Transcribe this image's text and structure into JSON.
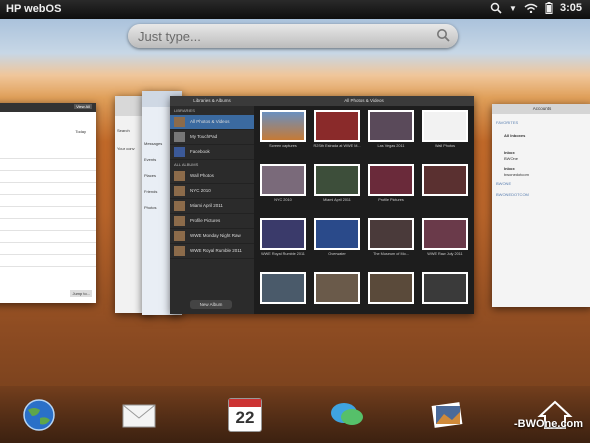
{
  "status_bar": {
    "title": "HP webOS",
    "time": "3:05"
  },
  "search": {
    "placeholder": "Just type..."
  },
  "card_left": {
    "view_all": "View All",
    "today": "Today",
    "jump_to": "Jump to..."
  },
  "card_second": {
    "search": "Search",
    "label": "Your conv"
  },
  "card_third": {
    "items": [
      "Messages",
      "Events",
      "Places",
      "Friends",
      "Photos"
    ]
  },
  "photos_app": {
    "libraries_header": "Libraries & Albums",
    "main_header": "All Photos & Videos",
    "libraries_label": "LIBRARIES",
    "all_albums_label": "ALL ALBUMS",
    "libraries": [
      "All Photos & Videos",
      "My TouchPad",
      "Facebook"
    ],
    "albums": [
      "Wall Photos",
      "NYC 2010",
      "Miami April 2011",
      "Profile Pictures",
      "WWE Monday Night Raw",
      "WWE Royal Rumble 2011"
    ],
    "new_album": "New Album",
    "tiles": [
      "Screen captures",
      "R2Sth Estrada at WWE M...",
      "Las Vegas 2011",
      "Wall Photos",
      "NYC 2010",
      "Miami April 2011",
      "Profile Pictures",
      "",
      "WWE Royal Rumble 2011",
      "Overwater",
      "The Museum of Mo...",
      "WWE Raw July 2011"
    ]
  },
  "email_app": {
    "header": "Accounts",
    "favorites": "FAVORITES",
    "all_inboxes": "All Inboxes",
    "inbox1": "Inbox",
    "inbox1_sub": "BWOne",
    "inbox2": "Inbox",
    "inbox2_sub": "bwonedotcom",
    "account1": "BWONE",
    "account2": "BWONEDOTCOM"
  },
  "watermark": "-BWOne.com",
  "colors": {
    "selection": "#3b6aa0",
    "status_bar": "#0e0e0e"
  },
  "dock": [
    "globe-icon",
    "email-icon",
    "calendar-icon",
    "messaging-icon",
    "photos-icon",
    "home-icon"
  ],
  "calendar_day": "22"
}
